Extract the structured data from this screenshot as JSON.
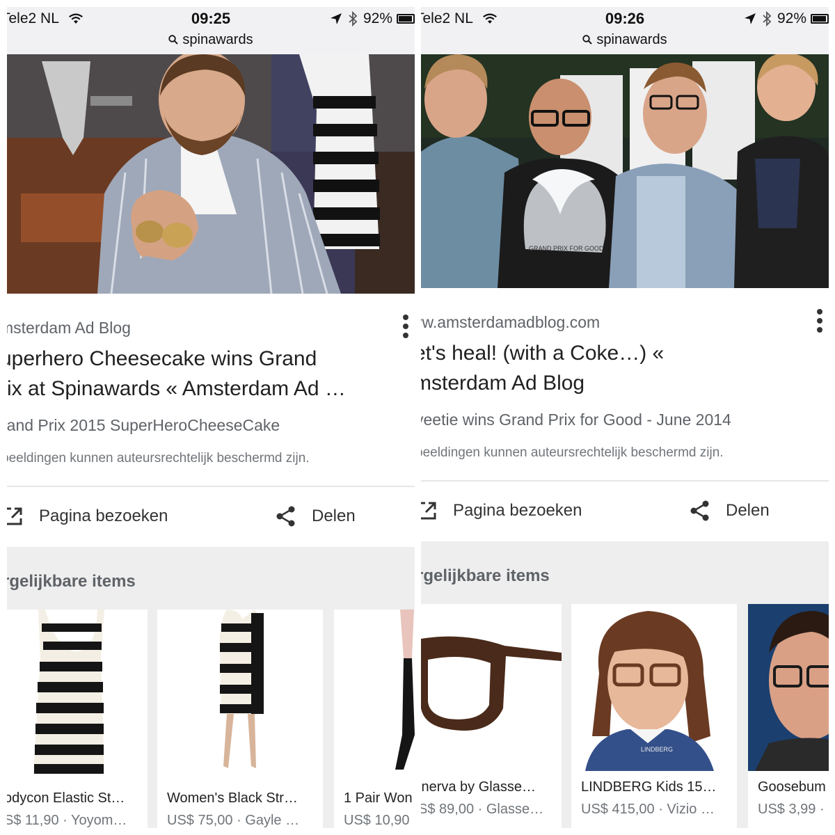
{
  "panels": [
    {
      "status": {
        "carrier": "Tele2 NL",
        "time": "09:25",
        "battery": "92%",
        "search": "spinawards"
      },
      "source": "msterdam Ad Blog",
      "title_line1": "uperhero Cheesecake wins Grand",
      "title_line2": "rix at Spinawards « Amsterdam Ad …",
      "caption": "rand Prix 2015 SuperHeroCheeseCake",
      "notice": "beeldingen kunnen auteursrechtelijk beschermd zijn.",
      "actions": {
        "visit": "Pagina bezoeken",
        "share": "Delen"
      },
      "related_title": "rgelijkbare items",
      "items": [
        {
          "name": "odycon Elastic St…",
          "price": "S$ 11,90 · Yoyom…"
        },
        {
          "name": "Women's Black Str…",
          "price": "US$ 75,00 · Gayle …"
        },
        {
          "name": "1 Pair Won",
          "price": "US$ 10,90"
        }
      ]
    },
    {
      "status": {
        "carrier": "Tele2 NL",
        "time": "09:26",
        "battery": "92%",
        "search": "spinawards"
      },
      "source": "vw.amsterdamadblog.com",
      "title_line1": "et's heal! (with a Coke…) «",
      "title_line2": "msterdam Ad Blog",
      "caption": "veetie wins Grand Prix for Good - June 2014",
      "notice": "beeldingen kunnen auteursrechtelijk beschermd zijn.",
      "actions": {
        "visit": "Pagina bezoeken",
        "share": "Delen"
      },
      "related_title": "rgelijkbare items",
      "trophy_text": "GRAND PRIX FOR GOOD",
      "brand_text": "LINDBERG",
      "items": [
        {
          "name": "inerva by Glasse…",
          "price": "S$ 89,00 · Glasse…"
        },
        {
          "name": "LINDBERG Kids 15…",
          "price": "US$ 415,00 · Vizio …"
        },
        {
          "name": "Goosebum",
          "price": "US$ 3,99 ·"
        }
      ]
    }
  ],
  "icons": {
    "wifi": "wifi-icon",
    "location": "location-arrow-icon",
    "bluetooth": "bluetooth-icon",
    "battery": "battery-icon",
    "search": "search-icon",
    "more": "more-vert-icon",
    "open": "open-in-new-icon",
    "share": "share-icon"
  },
  "colors": {
    "statusbar": "#f1f1f3",
    "related_bg": "#eeeeee",
    "secondary_text": "#5f6368"
  }
}
